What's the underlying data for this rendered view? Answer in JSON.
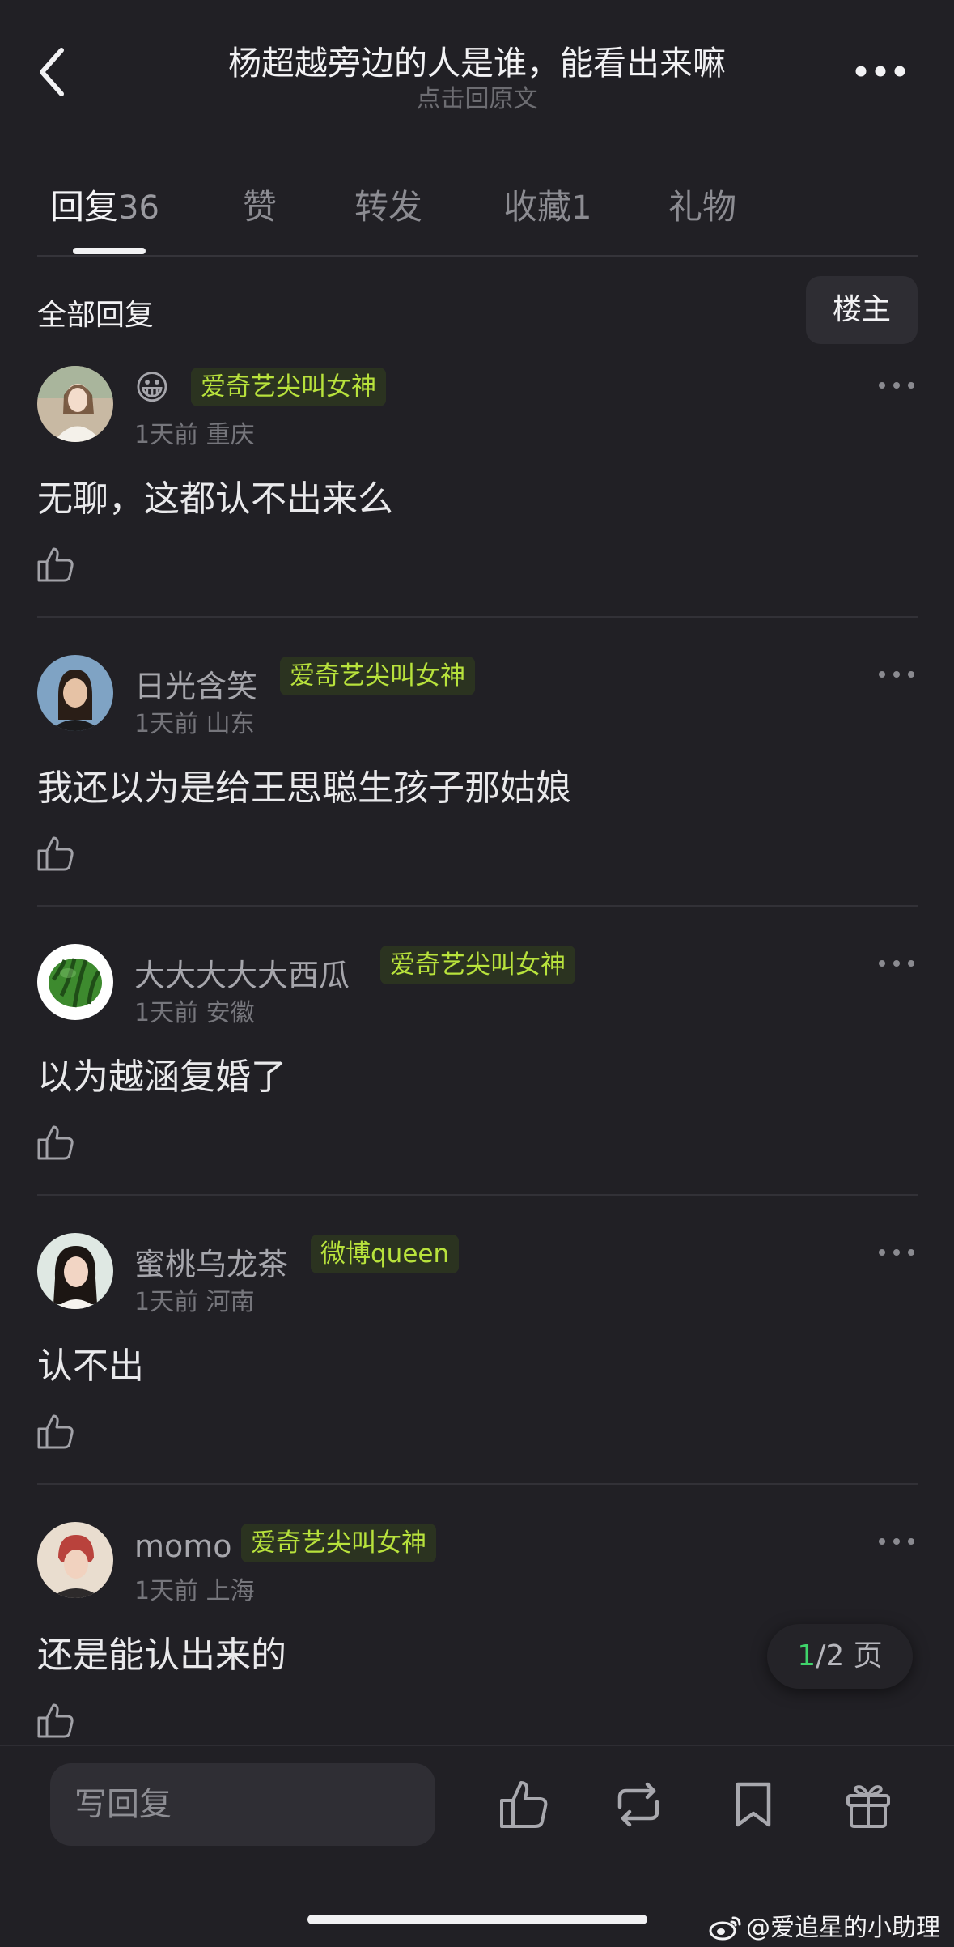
{
  "header": {
    "title": "杨超越旁边的人是谁，能看出来嘛",
    "subtitle": "点击回原文"
  },
  "tabs": [
    {
      "label": "回复",
      "count": "36"
    },
    {
      "label": "赞",
      "count": ""
    },
    {
      "label": "转发",
      "count": ""
    },
    {
      "label": "收藏",
      "count": "1"
    },
    {
      "label": "礼物",
      "count": ""
    }
  ],
  "section": {
    "title": "全部回复",
    "owner_button": "楼主"
  },
  "comments": [
    {
      "username": "😀",
      "badge": "爱奇艺尖叫女神",
      "time": "1天前",
      "location": "重庆",
      "text": "无聊，这都认不出来么"
    },
    {
      "username": "日光含笑",
      "badge": "爱奇艺尖叫女神",
      "time": "1天前",
      "location": "山东",
      "text": "我还以为是给王思聪生孩子那姑娘"
    },
    {
      "username": "大大大大大西瓜",
      "badge": "爱奇艺尖叫女神",
      "time": "1天前",
      "location": "安徽",
      "text": "以为越涵复婚了"
    },
    {
      "username": "蜜桃乌龙茶",
      "badge": "微博queen",
      "time": "1天前",
      "location": "河南",
      "text": "认不出"
    },
    {
      "username": "momo",
      "badge": "爱奇艺尖叫女神",
      "time": "1天前",
      "location": "上海",
      "text": "还是能认出来的"
    }
  ],
  "pagination": {
    "current": "1",
    "rest": "/2 页"
  },
  "bottom_bar": {
    "reply_placeholder": "写回复"
  },
  "watermark": "@爱追星的小助理",
  "colors": {
    "background": "#212025",
    "badge_text": "#b8e23c",
    "badge_bg": "#2b3320",
    "page_current": "#3fd36a"
  },
  "icons": [
    "back-icon",
    "more-icon",
    "thumbs-up-icon",
    "repost-icon",
    "bookmark-icon",
    "gift-icon",
    "weibo-icon"
  ]
}
